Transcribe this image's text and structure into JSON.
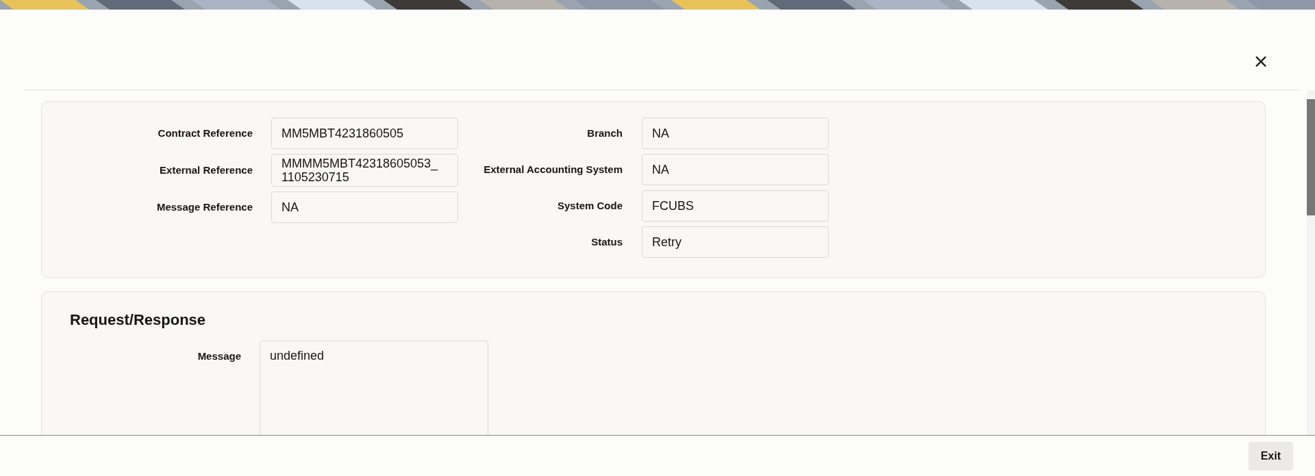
{
  "details": {
    "left_fields": [
      {
        "label": "Contract Reference",
        "value": "MM5MBT4231860505"
      },
      {
        "label": "External Reference",
        "value": "MMMM5MBT42318605053_1105230715"
      },
      {
        "label": "Message Reference",
        "value": "NA"
      }
    ],
    "right_fields": [
      {
        "label": "Branch",
        "value": "NA"
      },
      {
        "label": "External Accounting System",
        "value": "NA"
      },
      {
        "label": "System Code",
        "value": "FCUBS"
      },
      {
        "label": "Status",
        "value": "Retry"
      }
    ]
  },
  "request_response": {
    "title": "Request/Response",
    "message_label": "Message",
    "message_value": "undefined"
  },
  "footer": {
    "exit_button": "Exit"
  }
}
